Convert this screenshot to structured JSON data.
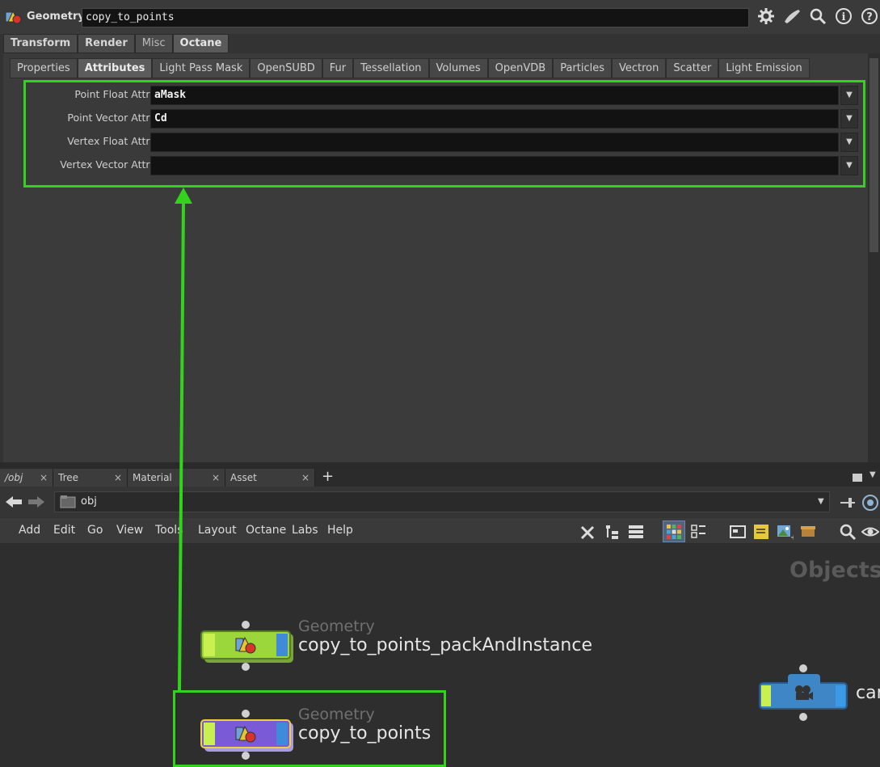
{
  "header": {
    "node_type": "Geometry",
    "node_name": "copy_to_points",
    "icons": [
      "gear-icon",
      "brush-icon",
      "search-icon",
      "info-icon",
      "help-icon"
    ]
  },
  "tabs_top": [
    {
      "label": "Transform"
    },
    {
      "label": "Render"
    },
    {
      "label": "Misc"
    },
    {
      "label": "Octane"
    }
  ],
  "tabs_sub": [
    {
      "label": "Properties"
    },
    {
      "label": "Attributes"
    },
    {
      "label": "Light Pass Mask"
    },
    {
      "label": "OpenSUBD"
    },
    {
      "label": "Fur"
    },
    {
      "label": "Tessellation"
    },
    {
      "label": "Volumes"
    },
    {
      "label": "OpenVDB"
    },
    {
      "label": "Particles"
    },
    {
      "label": "Vectron"
    },
    {
      "label": "Scatter"
    },
    {
      "label": "Light Emission"
    }
  ],
  "attributes": [
    {
      "label": "Point Float Attrs.",
      "value": "aMask"
    },
    {
      "label": "Point Vector Attrs.",
      "value": "Cd"
    },
    {
      "label": "Vertex Float Attrs.",
      "value": ""
    },
    {
      "label": "Vertex Vector Attrs.",
      "value": ""
    }
  ],
  "network_tabs": [
    {
      "label": "/obj"
    },
    {
      "label": "Tree View"
    },
    {
      "label": "Material Palette"
    },
    {
      "label": "Asset Browser"
    }
  ],
  "tab_close": "×",
  "add_tab": "+",
  "path": "obj",
  "menu": [
    "Add",
    "Edit",
    "Go",
    "View",
    "Tools",
    "Layout",
    "Octane",
    "Labs",
    "Help"
  ],
  "network_label": "Objects",
  "nodes": [
    {
      "category": "Geometry",
      "name": "copy_to_points_packAndInstance"
    },
    {
      "category": "Geometry",
      "name": "copy_to_points"
    },
    {
      "category": "",
      "name": "car"
    }
  ],
  "colors": {
    "highlight": "#32d21d",
    "node_green": "#9bd63a",
    "node_purple": "#7a5ad6",
    "node_blue": "#3f86c7"
  }
}
